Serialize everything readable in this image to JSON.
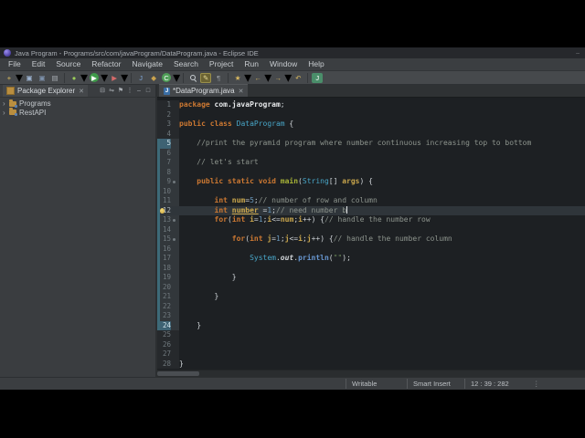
{
  "titlebar": {
    "title": "Java Program - Programs/src/com/javaProgram/DataProgram.java - Eclipse IDE",
    "window_controls": "‒"
  },
  "menubar": {
    "items": [
      "File",
      "Edit",
      "Source",
      "Refactor",
      "Navigate",
      "Search",
      "Project",
      "Run",
      "Window",
      "Help"
    ]
  },
  "toolbar": {
    "items": [
      {
        "name": "new-wizard-icon",
        "glyph": "+",
        "fg": "#e0c060",
        "dropdown": true
      },
      {
        "name": "save-icon",
        "glyph": "▣",
        "fg": "#9fb6d4"
      },
      {
        "name": "save-all-icon",
        "glyph": "▣",
        "fg": "#7e92ac"
      },
      {
        "name": "print-icon",
        "glyph": "▤",
        "fg": "#a8adb2"
      },
      {
        "sep": true
      },
      {
        "name": "debug-icon",
        "glyph": "●",
        "fg": "#9acd5a",
        "dropdown": true
      },
      {
        "name": "run-icon",
        "glyph": "▶",
        "fg": "#ffffff",
        "bg": "#3f9b4a",
        "round": true,
        "dropdown": true
      },
      {
        "name": "coverage-icon",
        "glyph": "▶",
        "fg": "#d46a6a",
        "dropdown": true
      },
      {
        "sep": true
      },
      {
        "name": "new-java-project-icon",
        "glyph": "J",
        "fg": "#7ea6d8"
      },
      {
        "name": "new-package-icon",
        "glyph": "◆",
        "fg": "#c9a24e"
      },
      {
        "name": "new-class-icon",
        "glyph": "C",
        "fg": "#ffffff",
        "bg": "#4f9e57",
        "round": true,
        "dropdown": true
      },
      {
        "sep": true
      },
      {
        "name": "search-icon",
        "glyph": "",
        "magnifier": true
      },
      {
        "name": "mark-occurrences-icon",
        "glyph": "✎",
        "fg": "#e8dc9a",
        "pressed": true
      },
      {
        "name": "show-whitespace-icon",
        "glyph": "¶",
        "fg": "#9aa0a5"
      },
      {
        "sep": true
      },
      {
        "name": "annotations-icon",
        "glyph": "★",
        "fg": "#d8b860",
        "dropdown": true
      },
      {
        "name": "back-icon",
        "glyph": "←",
        "fg": "#d8b860",
        "dropdown": true
      },
      {
        "name": "forward-icon",
        "glyph": "→",
        "fg": "#d8b860",
        "dropdown": true
      },
      {
        "name": "last-edit-location-icon",
        "glyph": "↶",
        "fg": "#d8b860"
      },
      {
        "sep": true
      },
      {
        "name": "java-perspective-icon",
        "glyph": "J",
        "fg": "#ffffff",
        "bg": "#4a8e6a"
      }
    ]
  },
  "explorer": {
    "tab_label": "Package Explorer",
    "close_glyph": "✕",
    "header_icons": [
      {
        "name": "collapse-all-icon",
        "glyph": "⊟"
      },
      {
        "name": "link-with-editor-icon",
        "glyph": "⇋"
      },
      {
        "name": "filter-icon",
        "glyph": "⚑"
      },
      {
        "name": "view-menu-icon",
        "glyph": "⋮"
      },
      {
        "name": "minimize-icon",
        "glyph": "–"
      },
      {
        "name": "maximize-icon",
        "glyph": "□"
      }
    ],
    "items": [
      {
        "label": "Programs",
        "expander": "›"
      },
      {
        "label": "RestAPI",
        "expander": "›"
      }
    ]
  },
  "editor": {
    "tab_label": "*DataProgram.java",
    "close_glyph": "✕",
    "code": {
      "range_indicator_lines": [
        5,
        24
      ],
      "range_endpoints": [
        5,
        24
      ],
      "current_line": 12,
      "fold_marker_lines": [
        9,
        13,
        15
      ],
      "lightbulb_line": 12,
      "lines": [
        {
          "n": 1,
          "ind": 0,
          "tokens": [
            [
              "k",
              "package "
            ],
            [
              "b",
              "com.javaProgram"
            ],
            [
              "p",
              ";"
            ]
          ]
        },
        {
          "n": 2,
          "ind": 0,
          "tokens": []
        },
        {
          "n": 3,
          "ind": 0,
          "tokens": [
            [
              "k",
              "public class "
            ],
            [
              "t",
              "DataProgram"
            ],
            [
              "p",
              " {"
            ]
          ]
        },
        {
          "n": 4,
          "ind": 0,
          "tokens": []
        },
        {
          "n": 5,
          "ind": 1,
          "tokens": [
            [
              "c",
              "//print the pyramid program where number continuous increasing top to bottom"
            ]
          ]
        },
        {
          "n": 6,
          "ind": 0,
          "tokens": []
        },
        {
          "n": 7,
          "ind": 1,
          "tokens": [
            [
              "c",
              "// let's start"
            ]
          ]
        },
        {
          "n": 8,
          "ind": 0,
          "tokens": []
        },
        {
          "n": 9,
          "ind": 1,
          "tokens": [
            [
              "k",
              "public static void "
            ],
            [
              "m",
              "main"
            ],
            [
              "p",
              "("
            ],
            [
              "t",
              "String"
            ],
            [
              "p",
              "[] "
            ],
            [
              "v",
              "args"
            ],
            [
              "p",
              ") {"
            ]
          ]
        },
        {
          "n": 10,
          "ind": 0,
          "tokens": []
        },
        {
          "n": 11,
          "ind": 2,
          "tokens": [
            [
              "k",
              "int "
            ],
            [
              "v",
              "num"
            ],
            [
              "p",
              "="
            ],
            [
              "n",
              "5"
            ],
            [
              "p",
              ";"
            ],
            [
              "c",
              "// number of row and column"
            ]
          ]
        },
        {
          "n": 12,
          "ind": 2,
          "tokens": [
            [
              "k",
              "int "
            ],
            [
              "vu",
              "number"
            ],
            [
              "p",
              " ="
            ],
            [
              "n",
              "1"
            ],
            [
              "p",
              ";"
            ],
            [
              "c",
              "// need number b"
            ]
          ],
          "caret": true
        },
        {
          "n": 13,
          "ind": 2,
          "tokens": [
            [
              "k",
              "for"
            ],
            [
              "p",
              "("
            ],
            [
              "k",
              "int "
            ],
            [
              "v",
              "i"
            ],
            [
              "p",
              "="
            ],
            [
              "n",
              "1"
            ],
            [
              "p",
              ";"
            ],
            [
              "v",
              "i"
            ],
            [
              "p",
              "<="
            ],
            [
              "v",
              "num"
            ],
            [
              "p",
              ";"
            ],
            [
              "v",
              "i"
            ],
            [
              "p",
              "++) {"
            ],
            [
              "c",
              "// handle the number row"
            ]
          ]
        },
        {
          "n": 14,
          "ind": 0,
          "tokens": []
        },
        {
          "n": 15,
          "ind": 3,
          "tokens": [
            [
              "k",
              "for"
            ],
            [
              "p",
              "("
            ],
            [
              "k",
              "int "
            ],
            [
              "v",
              "j"
            ],
            [
              "p",
              "="
            ],
            [
              "n",
              "1"
            ],
            [
              "p",
              ";"
            ],
            [
              "v",
              "j"
            ],
            [
              "p",
              "<="
            ],
            [
              "v",
              "i"
            ],
            [
              "p",
              ";"
            ],
            [
              "v",
              "j"
            ],
            [
              "p",
              "++) {"
            ],
            [
              "c",
              "// handle the number column"
            ]
          ]
        },
        {
          "n": 16,
          "ind": 0,
          "tokens": []
        },
        {
          "n": 17,
          "ind": 4,
          "tokens": [
            [
              "t",
              "System"
            ],
            [
              "p",
              "."
            ],
            [
              "i",
              "out"
            ],
            [
              "p",
              "."
            ],
            [
              "f",
              "println"
            ],
            [
              "p",
              "("
            ],
            [
              "s",
              "\"\""
            ],
            [
              "p",
              ");"
            ]
          ]
        },
        {
          "n": 18,
          "ind": 0,
          "tokens": []
        },
        {
          "n": 19,
          "ind": 3,
          "tokens": [
            [
              "p",
              "}"
            ]
          ]
        },
        {
          "n": 20,
          "ind": 0,
          "tokens": []
        },
        {
          "n": 21,
          "ind": 2,
          "tokens": [
            [
              "p",
              "}"
            ]
          ]
        },
        {
          "n": 22,
          "ind": 0,
          "tokens": []
        },
        {
          "n": 23,
          "ind": 0,
          "tokens": []
        },
        {
          "n": 24,
          "ind": 1,
          "tokens": [
            [
              "p",
              "}"
            ]
          ]
        },
        {
          "n": 25,
          "ind": 0,
          "tokens": []
        },
        {
          "n": 26,
          "ind": 0,
          "tokens": []
        },
        {
          "n": 27,
          "ind": 0,
          "tokens": []
        },
        {
          "n": 28,
          "ind": 0,
          "tokens": [
            [
              "p",
              "}"
            ]
          ]
        }
      ]
    }
  },
  "statusbar": {
    "cells": [
      {
        "name": "writable-status",
        "label": "Writable",
        "width": 60
      },
      {
        "name": "insert-mode-status",
        "label": "Smart Insert",
        "width": 56
      },
      {
        "name": "cursor-position-status",
        "label": "12 : 39 : 282",
        "width": 62
      }
    ],
    "trailing_glyph": "⋮"
  },
  "colors": {
    "keyword": "#CC7832",
    "type": "#48A6C8",
    "variable": "#C9A64C",
    "number": "#6897BB",
    "comment": "#8D948D",
    "string": "#6A8759",
    "plain": "#CED3D7",
    "method_decl": "#A8B437",
    "method_call": "#6897D1",
    "field": "#D0D4D8",
    "range_indicator": "#3D6A78",
    "range_endpoint": "#3E6273",
    "current_line_bg": "#2F353A",
    "editor_bg": "#1D2023",
    "chrome_bg": "#3C3F41"
  }
}
